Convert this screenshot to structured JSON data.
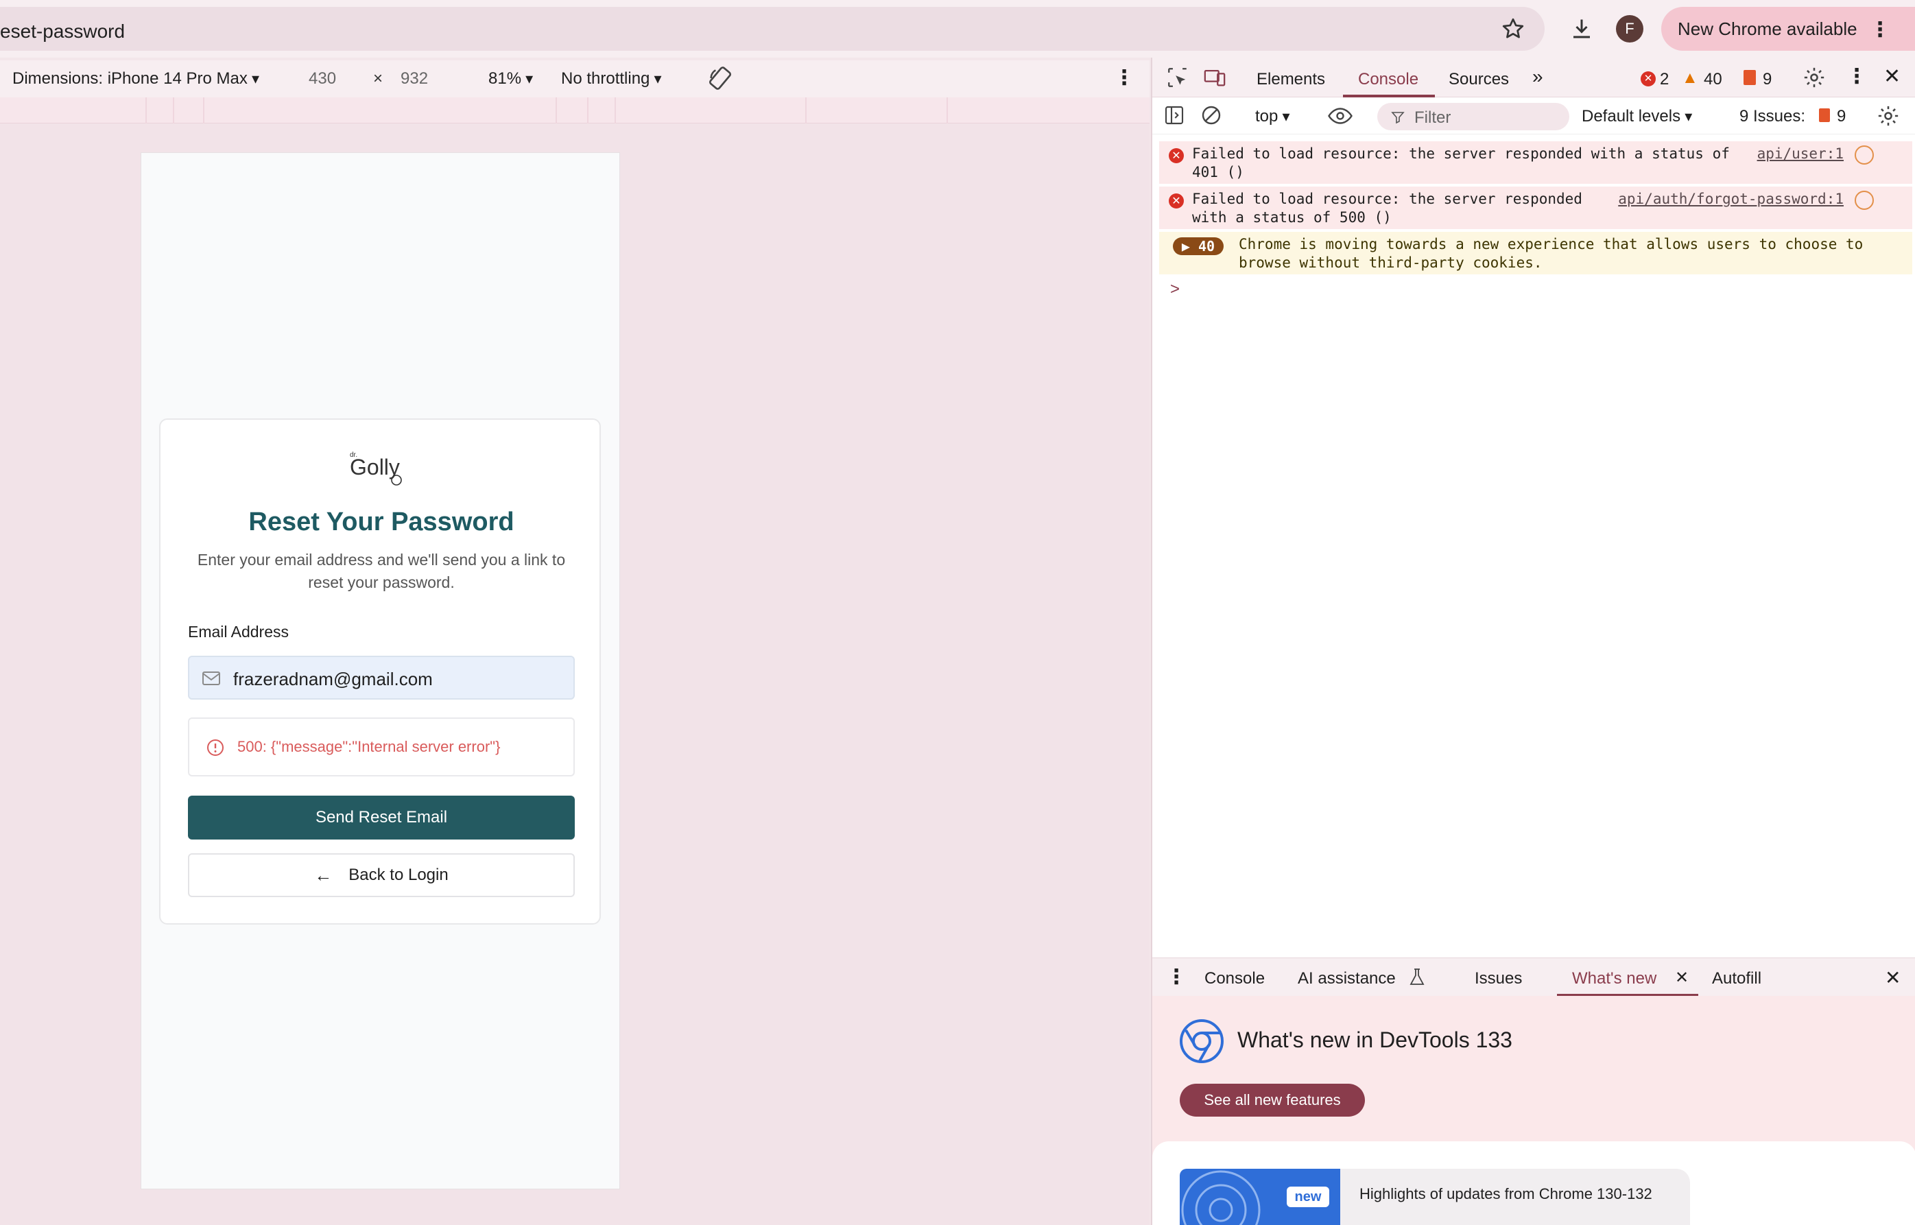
{
  "browser": {
    "url": "eset-password",
    "profile_initial": "F",
    "update_button": "New Chrome available"
  },
  "device_toolbar": {
    "dimensions": "Dimensions: iPhone 14 Pro Max",
    "width": "430",
    "times": "×",
    "height": "932",
    "zoom": "81%",
    "throttling": "No throttling"
  },
  "page": {
    "title": "Reset Your Password",
    "subtitle": "Enter your email address and we'll send you a link to reset your password.",
    "email_label": "Email Address",
    "email_value": "frazeradnam@gmail.com",
    "error_message": "500: {\"message\":\"Internal server error\"}",
    "send_button": "Send Reset Email",
    "back_button": "Back to Login",
    "logo_text": "Golly",
    "logo_prefix": "dr."
  },
  "devtools": {
    "tabs": [
      "Elements",
      "Console",
      "Sources"
    ],
    "more_tabs": "»",
    "error_count": "2",
    "warning_count": "40",
    "issue_count": "9",
    "context": "top",
    "filter_placeholder": "Filter",
    "levels": "Default levels",
    "issues_label": "9 Issues:",
    "issues_badge_count": "9",
    "messages": [
      {
        "type": "error",
        "text": "Failed to load resource: the server responded with a status of 401 ()",
        "source": "api/user:1"
      },
      {
        "type": "error",
        "text": "Failed to load resource: the server responded with a status of 500 ()",
        "source": "api/auth/forgot-password:1"
      },
      {
        "type": "warning",
        "count": "40",
        "text": "Chrome is moving towards a new experience that allows users to choose to browse without third-party cookies."
      }
    ],
    "prompt": ">"
  },
  "drawer": {
    "tabs": {
      "console": "Console",
      "ai": "AI assistance",
      "issues": "Issues",
      "whatsnew": "What's new",
      "autofill": "Autofill"
    },
    "title": "What's new in DevTools 133",
    "see_all": "See all new features",
    "badge": "new",
    "highlight": "Highlights of updates from Chrome 130-132"
  },
  "colors": {
    "accent": "#8a3c4c",
    "brand_teal": "#245a61",
    "error_red": "#d95b5b"
  }
}
